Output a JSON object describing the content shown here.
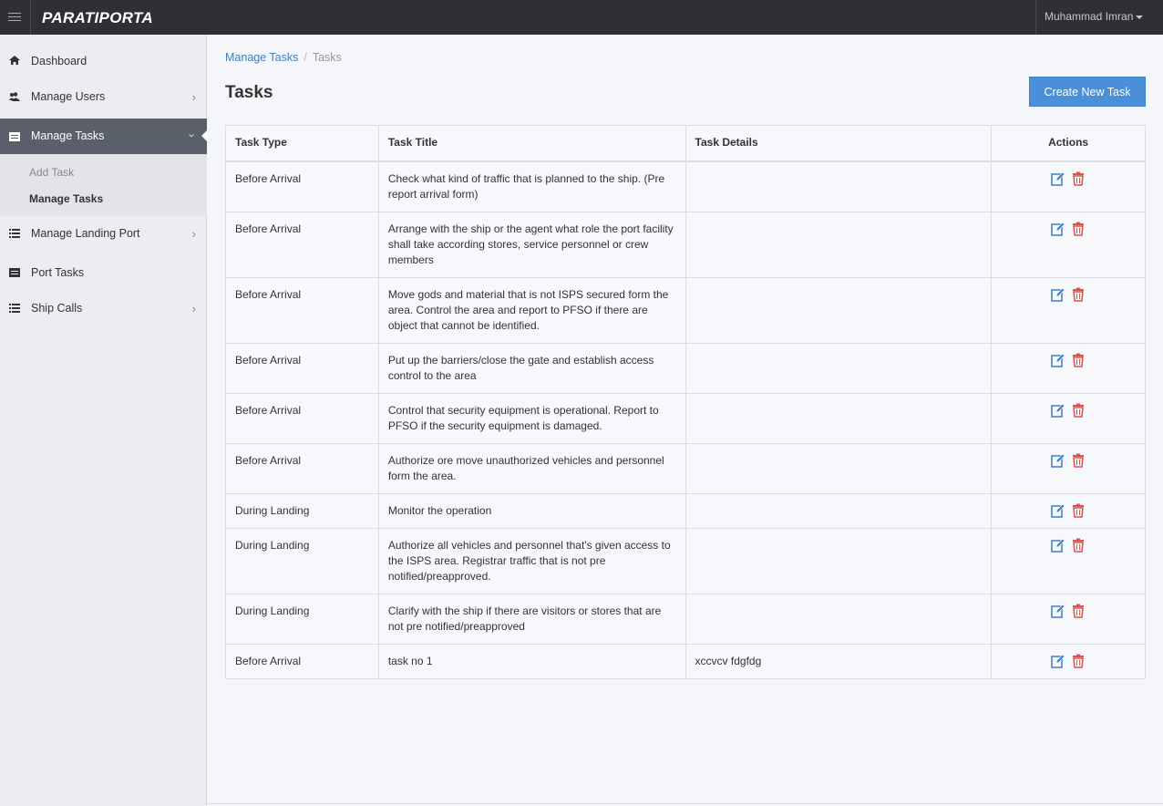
{
  "app": {
    "brand": "PARATIPORTA",
    "user_name": "Muhammad Imran"
  },
  "sidebar": {
    "items": [
      {
        "label": "Dashboard",
        "icon": "home-icon"
      },
      {
        "label": "Manage Users",
        "icon": "users-icon"
      },
      {
        "label": "Manage Tasks",
        "icon": "tasks-icon",
        "active": true
      },
      {
        "label": "Manage Landing Port",
        "icon": "list-icon"
      },
      {
        "label": "Port Tasks",
        "icon": "tasks-icon"
      },
      {
        "label": "Ship Calls",
        "icon": "list-icon"
      }
    ],
    "submenu": [
      {
        "label": "Add Task"
      },
      {
        "label": "Manage Tasks",
        "active": true
      }
    ]
  },
  "breadcrumb": {
    "parent": "Manage Tasks",
    "separator": "/",
    "current": "Tasks"
  },
  "page": {
    "title": "Tasks",
    "create_button": "Create New Task"
  },
  "table": {
    "headers": [
      "Task Type",
      "Task Title",
      "Task Details",
      "Actions"
    ],
    "rows": [
      {
        "type": "Before Arrival",
        "title": "Check what kind of traffic that is planned to the ship. (Pre report arrival form)",
        "details": ""
      },
      {
        "type": "Before Arrival",
        "title": "Arrange with the ship or the agent what role the port facility shall take according stores, service personnel or crew members",
        "details": ""
      },
      {
        "type": "Before Arrival",
        "title": "Move gods and material that is not ISPS secured form the area. Control the area and report to PFSO if there are object that cannot be identified.",
        "details": ""
      },
      {
        "type": "Before Arrival",
        "title": "Put up the barriers/close the gate and establish access control to the area",
        "details": ""
      },
      {
        "type": "Before Arrival",
        "title": "Control that security equipment is operational. Report to PFSO if the security equipment is damaged.",
        "details": ""
      },
      {
        "type": "Before Arrival",
        "title": "Authorize ore move unauthorized vehicles and personnel form the area.",
        "details": ""
      },
      {
        "type": "During Landing",
        "title": "Monitor the operation",
        "details": ""
      },
      {
        "type": "During Landing",
        "title": "Authorize all vehicles and personnel that's given access to the ISPS area. Registrar traffic that is not pre notified/preapproved.",
        "details": ""
      },
      {
        "type": "During Landing",
        "title": "Clarify with the ship if there are visitors or stores that are not pre notified/preapproved",
        "details": ""
      },
      {
        "type": "Before Arrival",
        "title": "task no 1",
        "details": "xccvcv fdgfdg"
      }
    ]
  },
  "colors": {
    "topbar": "#2f3033",
    "sidebar": "#ecedf0",
    "active_nav": "#5a6069",
    "primary": "#4a90d9",
    "link": "#3c7fc2",
    "edit_icon": "#3a7fc4",
    "delete_icon": "#d9534f"
  }
}
